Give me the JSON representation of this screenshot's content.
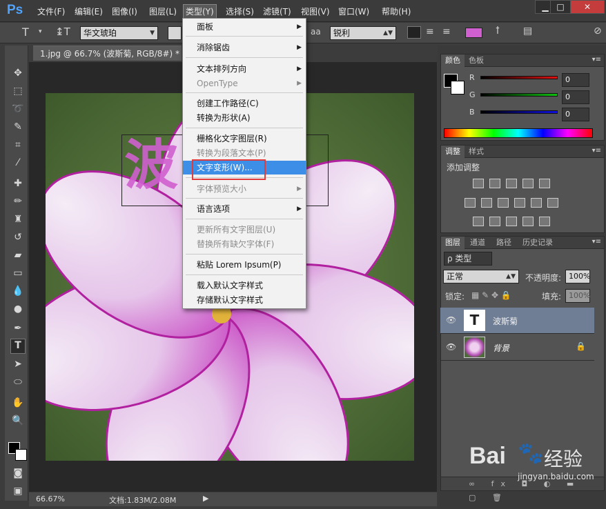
{
  "app": {
    "logo": "Ps"
  },
  "menubar": {
    "items": [
      "文件(F)",
      "编辑(E)",
      "图像(I)",
      "图层(L)",
      "类型(Y)",
      "选择(S)",
      "滤镜(T)",
      "视图(V)",
      "窗口(W)",
      "帮助(H)"
    ],
    "active": "类型(Y)",
    "window_buttons": [
      "▁",
      "□",
      "✕"
    ]
  },
  "options": {
    "font_family": "华文琥珀",
    "aa_label": "aa",
    "antialias": "锐利",
    "text_color": "#d060d0"
  },
  "document": {
    "tab_title": "1.jpg @ 66.7% (波斯菊, RGB/8#) *",
    "canvas_text": "波斯菊",
    "zoom": "66.67%",
    "doc_size": "文档:1.83M/2.08M"
  },
  "type_menu": {
    "items": [
      {
        "label": "面板",
        "submenu": true,
        "disabled": false
      },
      {
        "label": "消除锯齿",
        "submenu": true,
        "disabled": false
      },
      {
        "label": "文本排列方向",
        "submenu": true,
        "disabled": false
      },
      {
        "label": "OpenType",
        "submenu": true,
        "disabled": true
      },
      {
        "label": "创建工作路径(C)",
        "submenu": false,
        "disabled": false
      },
      {
        "label": "转换为形状(A)",
        "submenu": false,
        "disabled": false
      },
      {
        "label": "栅格化文字图层(R)",
        "submenu": false,
        "disabled": false
      },
      {
        "label": "转换为段落文本(P)",
        "submenu": false,
        "disabled": true
      },
      {
        "label": "文字变形(W)...",
        "submenu": false,
        "disabled": false,
        "highlighted": true
      },
      {
        "label": "字体预览大小",
        "submenu": true,
        "disabled": true
      },
      {
        "label": "语言选项",
        "submenu": true,
        "disabled": false
      },
      {
        "label": "更新所有文字图层(U)",
        "submenu": false,
        "disabled": true
      },
      {
        "label": "替换所有缺欠字体(F)",
        "submenu": false,
        "disabled": true
      },
      {
        "label": "粘贴 Lorem Ipsum(P)",
        "submenu": false,
        "disabled": false
      },
      {
        "label": "载入默认文字样式",
        "submenu": false,
        "disabled": false
      },
      {
        "label": "存储默认文字样式",
        "submenu": false,
        "disabled": false
      }
    ]
  },
  "color_panel": {
    "tabs": [
      "颜色",
      "色板"
    ],
    "channels": [
      {
        "label": "R",
        "value": "0",
        "color": "#e01010"
      },
      {
        "label": "G",
        "value": "0",
        "color": "#10c010"
      },
      {
        "label": "B",
        "value": "0",
        "color": "#1010e0"
      }
    ]
  },
  "adjust_panel": {
    "tabs": [
      "调整",
      "样式"
    ],
    "title": "添加调整"
  },
  "layers_panel": {
    "tabs": [
      "图层",
      "通道",
      "路径",
      "历史记录"
    ],
    "filter": "ρ 类型",
    "blend_mode": "正常",
    "opacity_label": "不透明度:",
    "opacity": "100%",
    "lock_label": "锁定:",
    "fill_label": "填充:",
    "fill": "100%",
    "layers": [
      {
        "name": "波斯菊",
        "type": "text",
        "selected": true
      },
      {
        "name": "背景",
        "type": "image",
        "selected": false
      }
    ]
  },
  "watermark": {
    "text": "Bai",
    "brand": "经验",
    "url": "jingyan.baidu.com"
  }
}
